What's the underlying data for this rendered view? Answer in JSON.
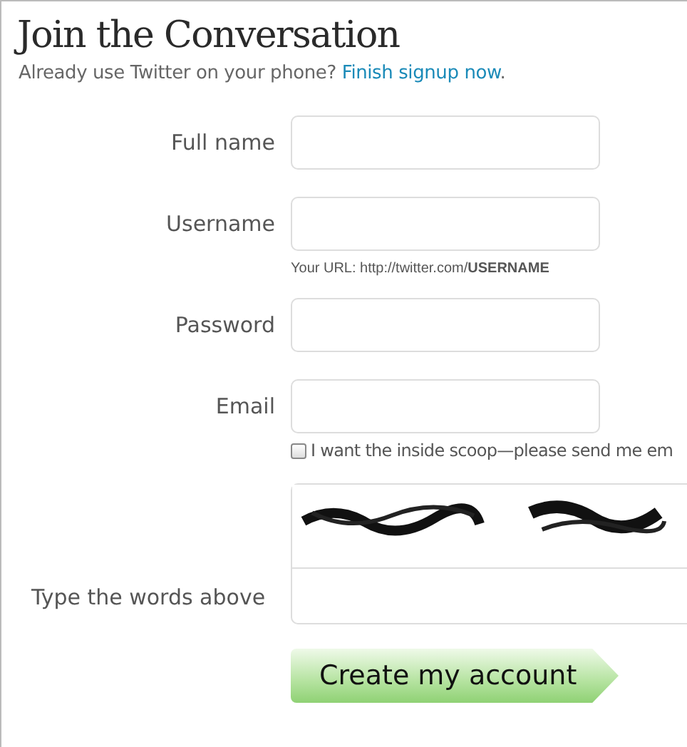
{
  "heading": "Join the Conversation",
  "intro": {
    "text": "Already use Twitter on your phone?",
    "link": "Finish signup now",
    "end": "."
  },
  "fields": [
    {
      "label": "Full name"
    },
    {
      "label": "Username",
      "hint": "Your URL: http://twitter.com/**USERNAME**"
    },
    {
      "label": "Password"
    },
    {
      "label": "Email",
      "checkbox": {
        "label": "I want the inside scoop—please send me em",
        "checked": false
      }
    }
  ],
  "captcha": {
    "kind": "picture",
    "label": "Type the words above"
  },
  "submit": "Create my account"
}
